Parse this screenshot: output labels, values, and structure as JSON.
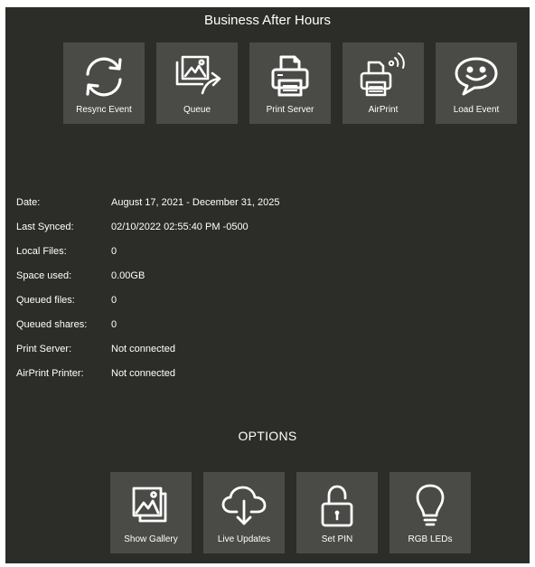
{
  "title": "Business After Hours",
  "top_buttons": [
    {
      "label": "Resync Event",
      "icon": "resync-icon"
    },
    {
      "label": "Queue",
      "icon": "queue-icon"
    },
    {
      "label": "Print Server",
      "icon": "printer-icon"
    },
    {
      "label": "AirPrint",
      "icon": "airprint-icon"
    },
    {
      "label": "Load Event",
      "icon": "chat-smile-icon"
    }
  ],
  "info": [
    {
      "key": "Date:",
      "value": "August 17, 2021 - December 31, 2025"
    },
    {
      "key": "Last Synced:",
      "value": "02/10/2022 02:55:40 PM -0500"
    },
    {
      "key": "Local Files:",
      "value": "0"
    },
    {
      "key": "Space used:",
      "value": "0.00GB"
    },
    {
      "key": "Queued files:",
      "value": "0"
    },
    {
      "key": "Queued shares:",
      "value": "0"
    },
    {
      "key": "Print Server:",
      "value": "Not connected"
    },
    {
      "key": "AirPrint Printer:",
      "value": "Not connected"
    }
  ],
  "options_heading": "OPTIONS",
  "option_buttons": [
    {
      "label": "Show Gallery",
      "icon": "gallery-icon"
    },
    {
      "label": "Live Updates",
      "icon": "cloud-download-icon"
    },
    {
      "label": "Set PIN",
      "icon": "unlock-icon"
    },
    {
      "label": "RGB LEDs",
      "icon": "lightbulb-icon"
    }
  ],
  "colors": {
    "background": "#2c2c28",
    "tile": "#4a4a46",
    "text": "#ffffff"
  }
}
